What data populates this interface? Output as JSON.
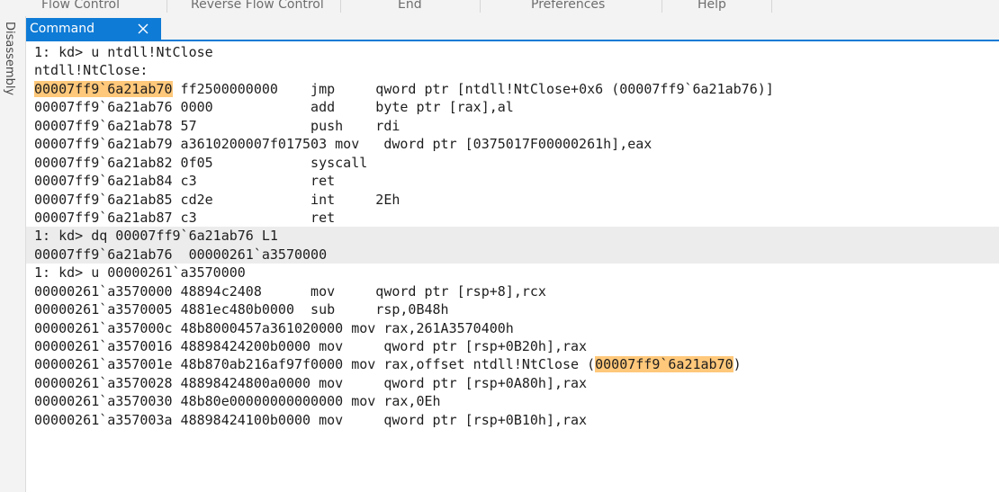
{
  "menu": {
    "items": [
      "Flow Control",
      "Reverse Flow Control",
      "End",
      "Preferences",
      "Help"
    ]
  },
  "left_dock": {
    "label": "Disassembly"
  },
  "tab": {
    "label": "Command",
    "close_icon": "close-icon"
  },
  "colors": {
    "accent": "#0e7bd6",
    "highlight": "#ffc87a",
    "shaded_line": "#ececec"
  },
  "output": {
    "lines": [
      {
        "segments": [
          {
            "text": "1: kd> u ntdll!NtClose"
          }
        ],
        "shaded": false
      },
      {
        "segments": [
          {
            "text": "ntdll!NtClose:"
          }
        ],
        "shaded": false
      },
      {
        "segments": [
          {
            "text": "00007ff9`6a21ab70",
            "highlight": true
          },
          {
            "text": " ff2500000000    jmp     qword ptr [ntdll!NtClose+0x6 (00007ff9`6a21ab76)]"
          }
        ],
        "shaded": false
      },
      {
        "segments": [
          {
            "text": "00007ff9`6a21ab76 0000            add     byte ptr [rax],al"
          }
        ],
        "shaded": false
      },
      {
        "segments": [
          {
            "text": "00007ff9`6a21ab78 57              push    rdi"
          }
        ],
        "shaded": false
      },
      {
        "segments": [
          {
            "text": "00007ff9`6a21ab79 a3610200007f017503 mov   dword ptr [0375017F00000261h],eax"
          }
        ],
        "shaded": false
      },
      {
        "segments": [
          {
            "text": "00007ff9`6a21ab82 0f05            syscall"
          }
        ],
        "shaded": false
      },
      {
        "segments": [
          {
            "text": "00007ff9`6a21ab84 c3              ret"
          }
        ],
        "shaded": false
      },
      {
        "segments": [
          {
            "text": "00007ff9`6a21ab85 cd2e            int     2Eh"
          }
        ],
        "shaded": false
      },
      {
        "segments": [
          {
            "text": "00007ff9`6a21ab87 c3              ret"
          }
        ],
        "shaded": false
      },
      {
        "segments": [
          {
            "text": "1: kd> dq 00007ff9`6a21ab76 L1"
          }
        ],
        "shaded": true
      },
      {
        "segments": [
          {
            "text": "00007ff9`6a21ab76  00000261`a3570000"
          }
        ],
        "shaded": true
      },
      {
        "segments": [
          {
            "text": "1: kd> u 00000261`a3570000"
          }
        ],
        "shaded": false
      },
      {
        "segments": [
          {
            "text": "00000261`a3570000 48894c2408      mov     qword ptr [rsp+8],rcx"
          }
        ],
        "shaded": false
      },
      {
        "segments": [
          {
            "text": "00000261`a3570005 4881ec480b0000  sub     rsp,0B48h"
          }
        ],
        "shaded": false
      },
      {
        "segments": [
          {
            "text": "00000261`a357000c 48b8000457a361020000 mov rax,261A3570400h"
          }
        ],
        "shaded": false
      },
      {
        "segments": [
          {
            "text": "00000261`a3570016 48898424200b0000 mov     qword ptr [rsp+0B20h],rax"
          }
        ],
        "shaded": false
      },
      {
        "segments": [
          {
            "text": "00000261`a357001e 48b870ab216af97f0000 mov rax,offset ntdll!NtClose ("
          },
          {
            "text": "00007ff9`6a21ab70",
            "highlight": true
          },
          {
            "text": ")"
          }
        ],
        "shaded": false
      },
      {
        "segments": [
          {
            "text": "00000261`a3570028 48898424800a0000 mov     qword ptr [rsp+0A80h],rax"
          }
        ],
        "shaded": false
      },
      {
        "segments": [
          {
            "text": "00000261`a3570030 48b80e00000000000000 mov rax,0Eh"
          }
        ],
        "shaded": false
      },
      {
        "segments": [
          {
            "text": "00000261`a357003a 48898424100b0000 mov     qword ptr [rsp+0B10h],rax"
          }
        ],
        "shaded": false
      }
    ]
  }
}
